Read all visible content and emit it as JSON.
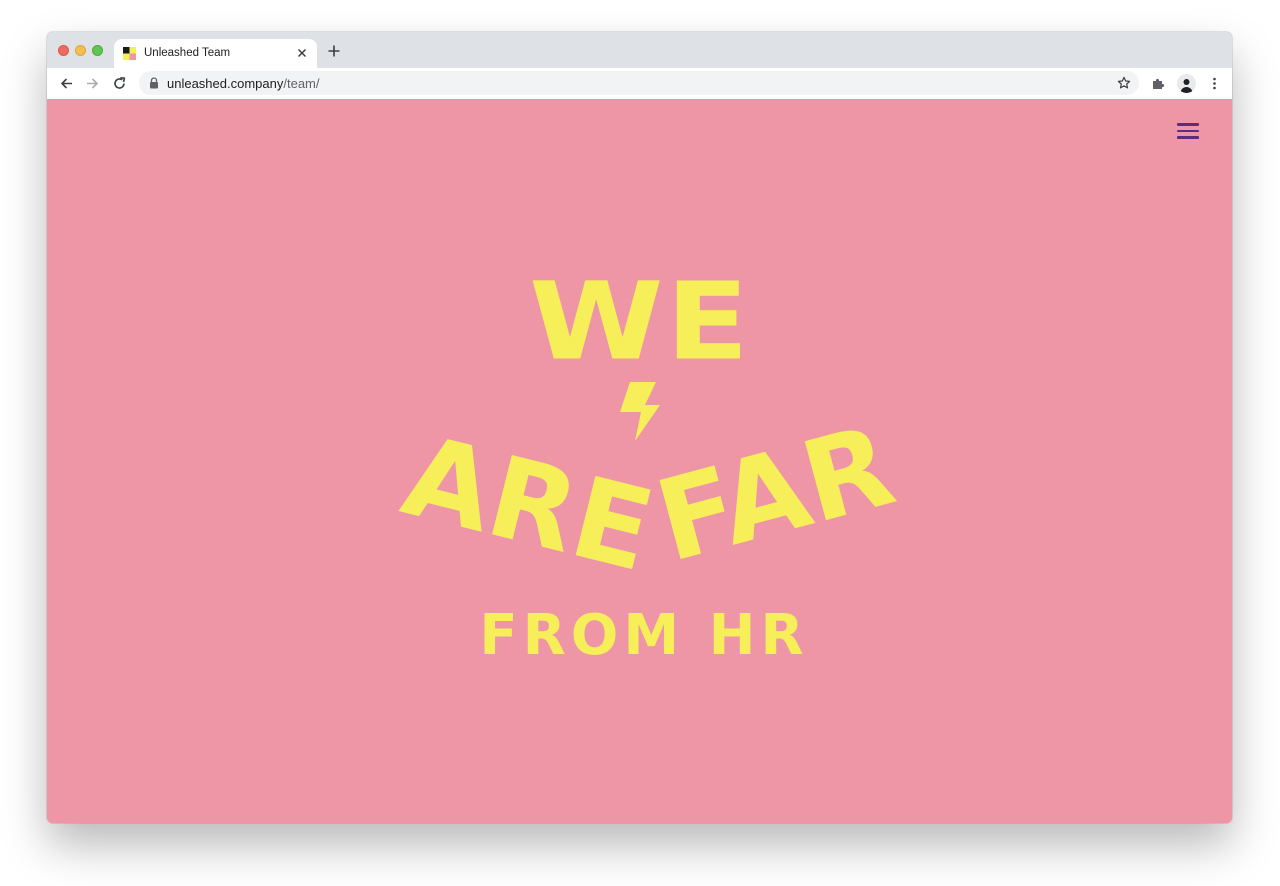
{
  "browser": {
    "tab_title": "Unleashed Team",
    "url_host": "unleashed.company",
    "url_path": "/team/"
  },
  "colors": {
    "page_background": "#ee95a6",
    "headline": "#f6ef5a",
    "menu_icon": "#5a2e7a"
  },
  "icons": [
    "close-icon",
    "plus-icon",
    "back-arrow-icon",
    "forward-arrow-icon",
    "reload-icon",
    "lock-icon",
    "star-icon",
    "extensions-icon",
    "avatar",
    "more-icon",
    "hamburger-menu-icon",
    "lightning-bolt-icon"
  ],
  "hero": {
    "line1": "WE",
    "line2_word1": "ARE",
    "line2_word2": "FAR",
    "line3": "FROM HR"
  }
}
